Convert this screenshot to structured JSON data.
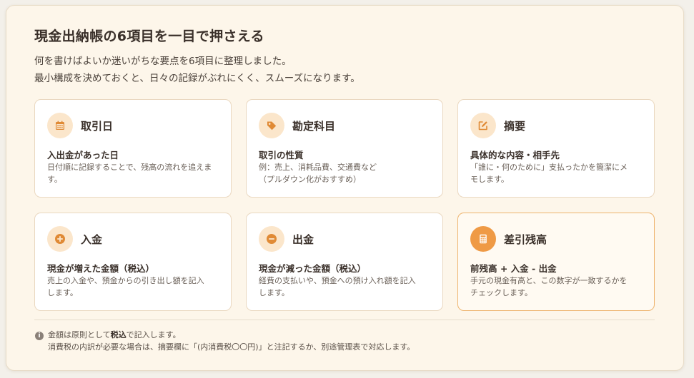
{
  "title": "現金出納帳の6項目を一目で押さえる",
  "intro": [
    "何を書けばよいか迷いがちな要点を6項目に整理しました。",
    "最小構成を決めておくと、日々の記録がぶれにくく、スムーズになります。"
  ],
  "colors": {
    "accent": "#ef9a45",
    "accent_light": "#fbe6cb",
    "panel_bg": "#fdf6ea",
    "text": "#3a302a"
  },
  "cards": [
    {
      "icon": "calendar-icon",
      "title": "取引日",
      "subtitle": "入出金があった日",
      "desc": [
        "日付順に記録することで、残高の流れを追えま",
        "す。"
      ]
    },
    {
      "icon": "tag-icon",
      "title": "勘定科目",
      "subtitle": "取引の性質",
      "desc": [
        "例：売上、消耗品費、交通費など",
        "（プルダウン化がおすすめ）"
      ]
    },
    {
      "icon": "edit-icon",
      "title": "摘要",
      "subtitle": "具体的な内容・相手先",
      "desc": [
        "「誰に・何のために」支払ったかを簡潔にメ",
        "モします。"
      ]
    },
    {
      "icon": "plus-circle-icon",
      "title": "入金",
      "subtitle": "現金が増えた金額（税込）",
      "desc": [
        "売上の入金や、預金からの引き出し額を記入",
        "します。"
      ]
    },
    {
      "icon": "minus-circle-icon",
      "title": "出金",
      "subtitle": "現金が減った金額（税込）",
      "desc": [
        "経費の支払いや、預金への預け入れ額を記入",
        "します。"
      ]
    },
    {
      "icon": "calculator-icon",
      "title": "差引残高",
      "subtitle": "前残高 + 入金 - 出金",
      "desc": [
        "手元の現金有高と、この数字が一致するかを",
        "チェックします。"
      ]
    }
  ],
  "note": {
    "icon": "info-icon",
    "line1_before": "金額は原則として",
    "line1_bold": "税込",
    "line1_after": "で記入します。",
    "line2": "消費税の内訳が必要な場合は、摘要欄に「(内消費税〇〇円)」と注記するか、別途管理表で対応します。"
  }
}
